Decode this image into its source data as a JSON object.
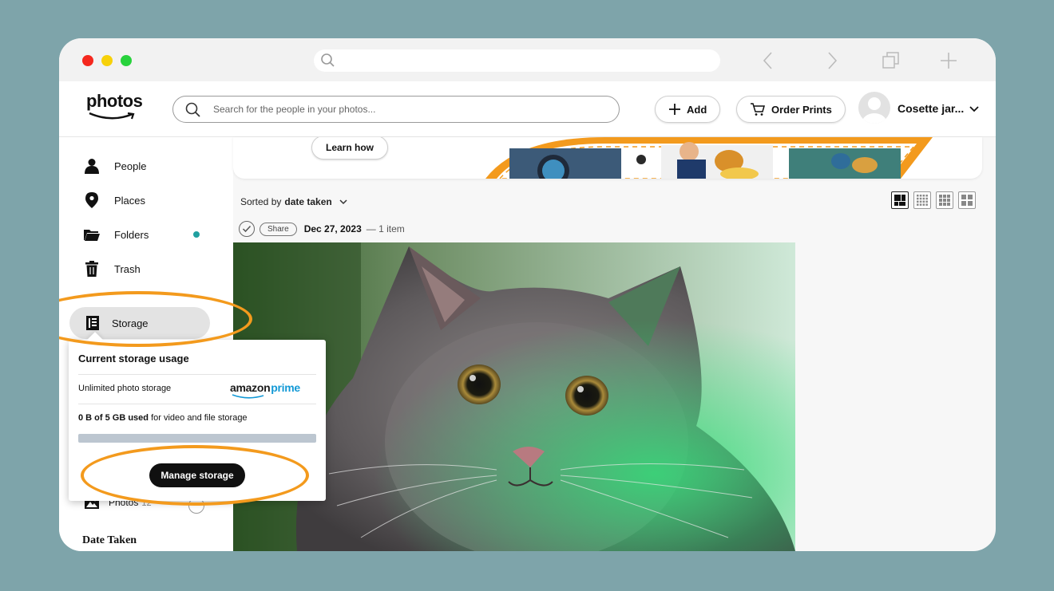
{
  "header": {
    "logo_text": "photos",
    "search_placeholder": "Search for the people in your photos...",
    "add_label": "Add",
    "order_prints_label": "Order Prints",
    "username": "Cosette jar..."
  },
  "sidebar": {
    "items": [
      {
        "label": "People",
        "icon": "person-icon"
      },
      {
        "label": "Places",
        "icon": "pin-icon"
      },
      {
        "label": "Folders",
        "icon": "folder-icon"
      },
      {
        "label": "Trash",
        "icon": "trash-icon"
      }
    ],
    "storage_label": "Storage",
    "photos_label": "Photos",
    "photos_count": "12",
    "date_taken_label": "Date Taken"
  },
  "storage_popover": {
    "title": "Current storage usage",
    "unlimited_label": "Unlimited photo storage",
    "prime_brand_left": "amazon",
    "prime_brand_right": "prime",
    "used_amount": "0 B of 5 GB used",
    "used_suffix": " for video and file storage",
    "used_fraction": 0,
    "manage_label": "Manage storage"
  },
  "main": {
    "learn_how_label": "Learn how",
    "sort_prefix": "Sorted by",
    "sort_value": "date taken",
    "group": {
      "share_label": "Share",
      "date": "Dec 27, 2023",
      "count": "— 1 item"
    }
  },
  "colors": {
    "accent_ring": "#f39a1d",
    "prime_blue": "#1399d6",
    "status_dot": "#20a0a0"
  }
}
